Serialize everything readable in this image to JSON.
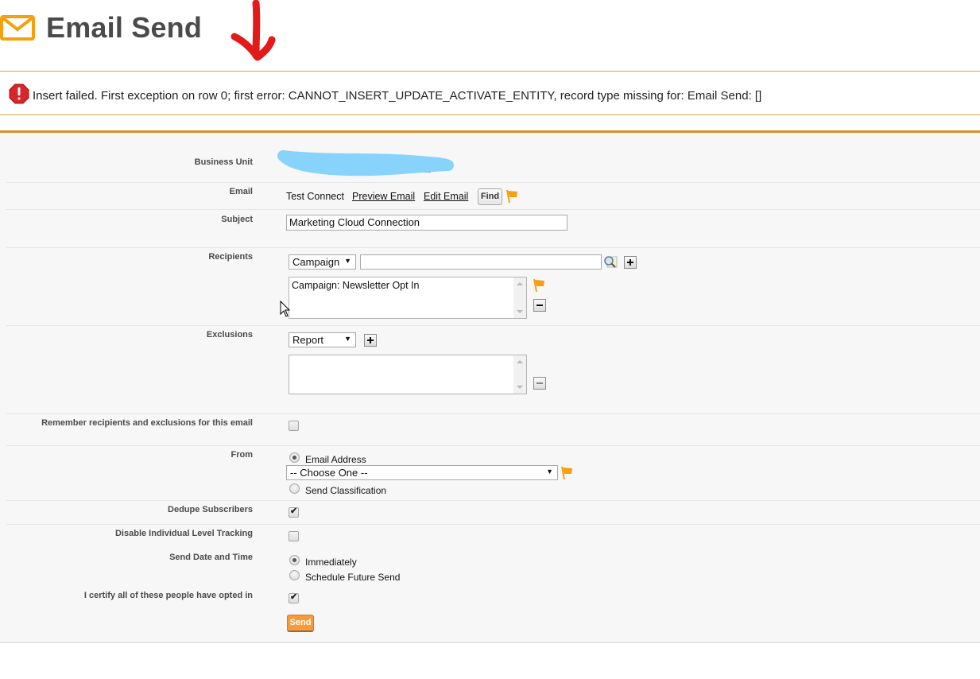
{
  "header": {
    "title": "Email Send",
    "icon": "envelope-icon",
    "annotation": "red-arrow-annotation"
  },
  "error": {
    "icon": "error-icon",
    "message": "Insert failed. First exception on row 0; first error: CANNOT_INSERT_UPDATE_ACTIVATE_ENTITY, record type missing for: Email Send: []"
  },
  "form": {
    "business_unit": {
      "label": "Business Unit",
      "value_redacted": true
    },
    "email": {
      "label": "Email",
      "name": "Test Connect",
      "preview_link": "Preview Email",
      "edit_link": "Edit Email",
      "find_button": "Find"
    },
    "subject": {
      "label": "Subject",
      "value": "Marketing Cloud Connection"
    },
    "recipients": {
      "label": "Recipients",
      "type_select": "Campaign",
      "search_value": "",
      "selected": [
        "Campaign: Newsletter Opt In"
      ]
    },
    "exclusions": {
      "label": "Exclusions",
      "type_select": "Report",
      "selected": []
    },
    "remember": {
      "label": "Remember recipients and exclusions for this email",
      "checked": false
    },
    "from": {
      "label": "From",
      "option_email": "Email Address",
      "option_classification": "Send Classification",
      "selected": "Email Address",
      "dropdown_value": "-- Choose One --"
    },
    "dedupe": {
      "label": "Dedupe Subscribers",
      "checked": true
    },
    "disable_tracking": {
      "label": "Disable Individual Level Tracking",
      "checked": false
    },
    "send_time": {
      "label": "Send Date and Time",
      "option_immediately": "Immediately",
      "option_schedule": "Schedule Future Send",
      "selected": "Immediately"
    },
    "certify": {
      "label": "I certify all of these people have opted in",
      "checked": true
    },
    "send_button": "Send"
  },
  "colors": {
    "accent_orange": "#d98f2a",
    "flag_orange": "#f5a00f",
    "send_button": "#f79a3a",
    "error_red": "#d9262b",
    "annotation_red": "#e21a1a",
    "redaction_blue": "#87d3fb"
  }
}
